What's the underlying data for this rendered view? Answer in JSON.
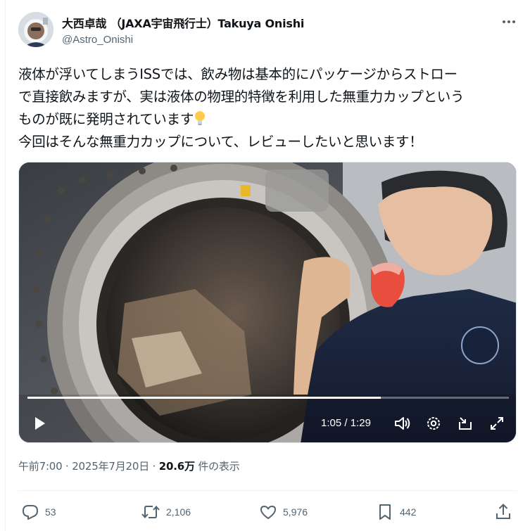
{
  "author": {
    "display_name": "大西卓哉 （JAXA宇宙飛行士）Takuya Onishi",
    "handle": "@Astro_Onishi"
  },
  "tweet": {
    "lines": [
      "液体が浮いてしまうISSでは、飲み物は基本的にパッケージからストロー",
      "で直接飲みますが、実は液体の物理的特徴を利用した無重力カップという",
      "ものが既に発明されています",
      "今回はそんな無重力カップについて、レビューしたいと思います！"
    ],
    "emoji": "light-bulb-emoji"
  },
  "video": {
    "current_time": "1:05",
    "separator": " / ",
    "duration": "1:29",
    "progress": 0.734
  },
  "meta": {
    "time": "午前7:00",
    "dot1": " · ",
    "date": "2025年7月20日",
    "dot2": " · ",
    "views_count": "20.6万",
    "views_label": " 件の表示"
  },
  "actions": {
    "replies": "53",
    "reposts": "2,106",
    "likes": "5,976",
    "bookmarks": "442"
  },
  "icons": [
    "more-icon",
    "play-icon",
    "volume-icon",
    "settings-icon",
    "pip-icon",
    "fullscreen-icon",
    "reply-icon",
    "repost-icon",
    "like-icon",
    "bookmark-icon",
    "share-icon"
  ],
  "colors": {
    "text": "#0f1419",
    "secondary": "#536471",
    "divider": "#eff3f4"
  }
}
